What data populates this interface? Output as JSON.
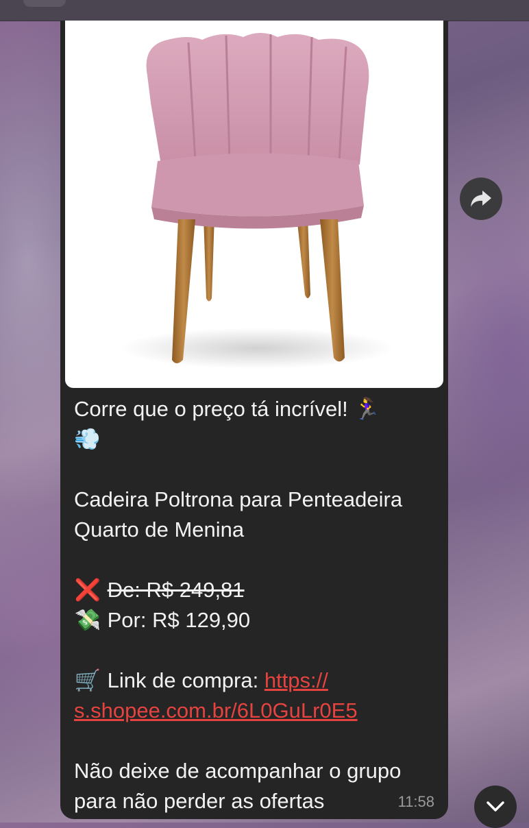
{
  "message": {
    "line1": "Corre que o preço tá incrível! 🏃‍♀️",
    "line2": "💨",
    "product_line1": "Cadeira Poltrona para Penteadeira",
    "product_line2": "Quarto de Menina",
    "old_price_icon": "❌",
    "old_price": "De: R$ 249,81",
    "new_price_icon": "💸",
    "new_price": "Por: R$ 129,90",
    "cart_icon": "🛒",
    "link_label": "Link de compra:",
    "link_url_part1": "https://",
    "link_url_part2": "s.shopee.com.br/6L0GuLr0E5",
    "footer_line1": "Não deixe de acompanhar o grupo",
    "footer_line2": "para não perder as ofertas",
    "time": "11:58"
  },
  "image": {
    "subject": "pink velvet scalloped-back chair with wooden legs",
    "colors": {
      "upholstery": "#d9a3b8",
      "legs": "#b07a3a",
      "background": "#ffffff"
    }
  },
  "buttons": {
    "forward_icon": "forward-arrow-icon",
    "scroll_down_icon": "chevron-down-icon"
  },
  "colors": {
    "bubble": "#252526",
    "link": "#e4433f",
    "text": "#f2f2f2",
    "timestamp": "#9a9a9a"
  }
}
